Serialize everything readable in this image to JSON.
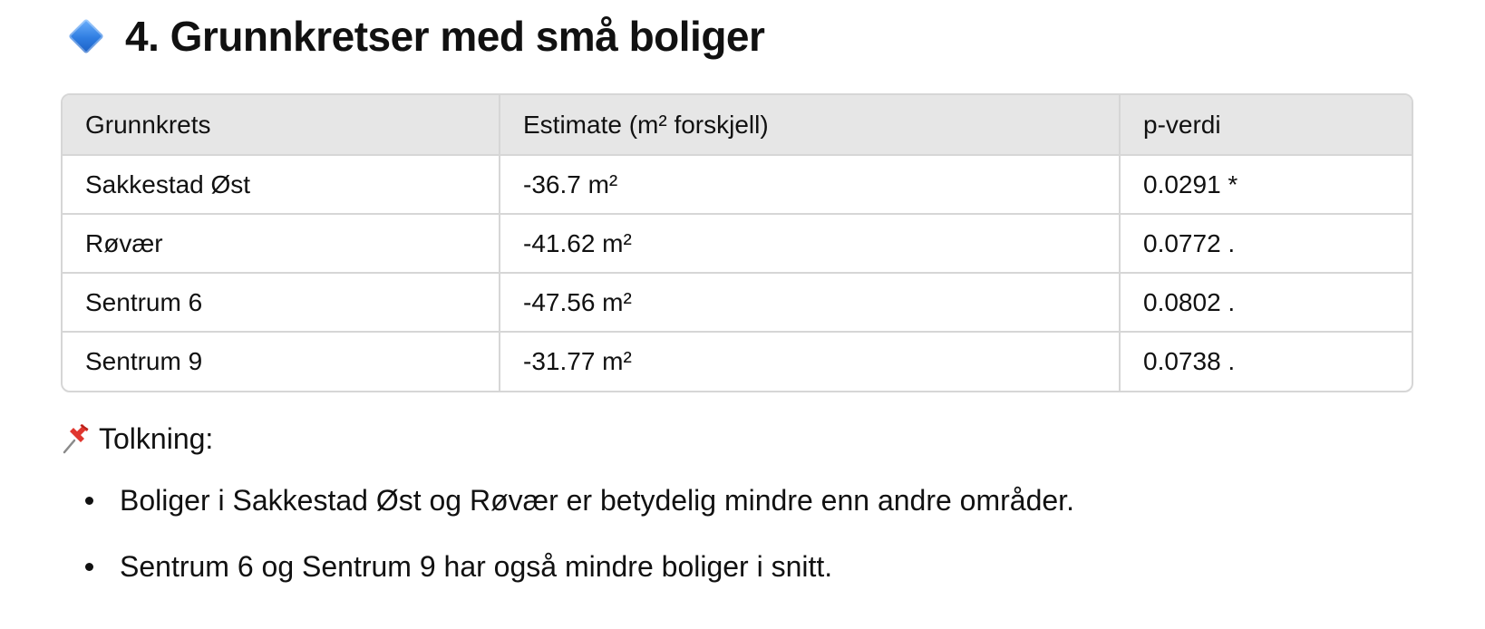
{
  "heading": {
    "icon": "blue-diamond-icon",
    "text": "4. Grunnkretser med små boliger"
  },
  "table": {
    "headers": [
      "Grunnkrets",
      "Estimate (m² forskjell)",
      "p-verdi"
    ],
    "rows": [
      [
        "Sakkestad Øst",
        "-36.7 m²",
        "0.0291 *"
      ],
      [
        "Røvær",
        "-41.62 m²",
        "0.0772 ."
      ],
      [
        "Sentrum 6",
        "-47.56 m²",
        "0.0802 ."
      ],
      [
        "Sentrum 9",
        "-31.77 m²",
        "0.0738 ."
      ]
    ]
  },
  "interpretation": {
    "icon": "pushpin-icon",
    "label": "Tolkning:",
    "bullets": [
      "Boliger i Sakkestad Øst og Røvær er betydelig mindre enn andre områder.",
      "Sentrum 6 og Sentrum 9 har også mindre boliger i snitt."
    ]
  },
  "colors": {
    "header_bg": "#e6e6e6",
    "border": "#d6d6d6",
    "diamond": "#2f7de1",
    "pin": "#e0362e"
  }
}
